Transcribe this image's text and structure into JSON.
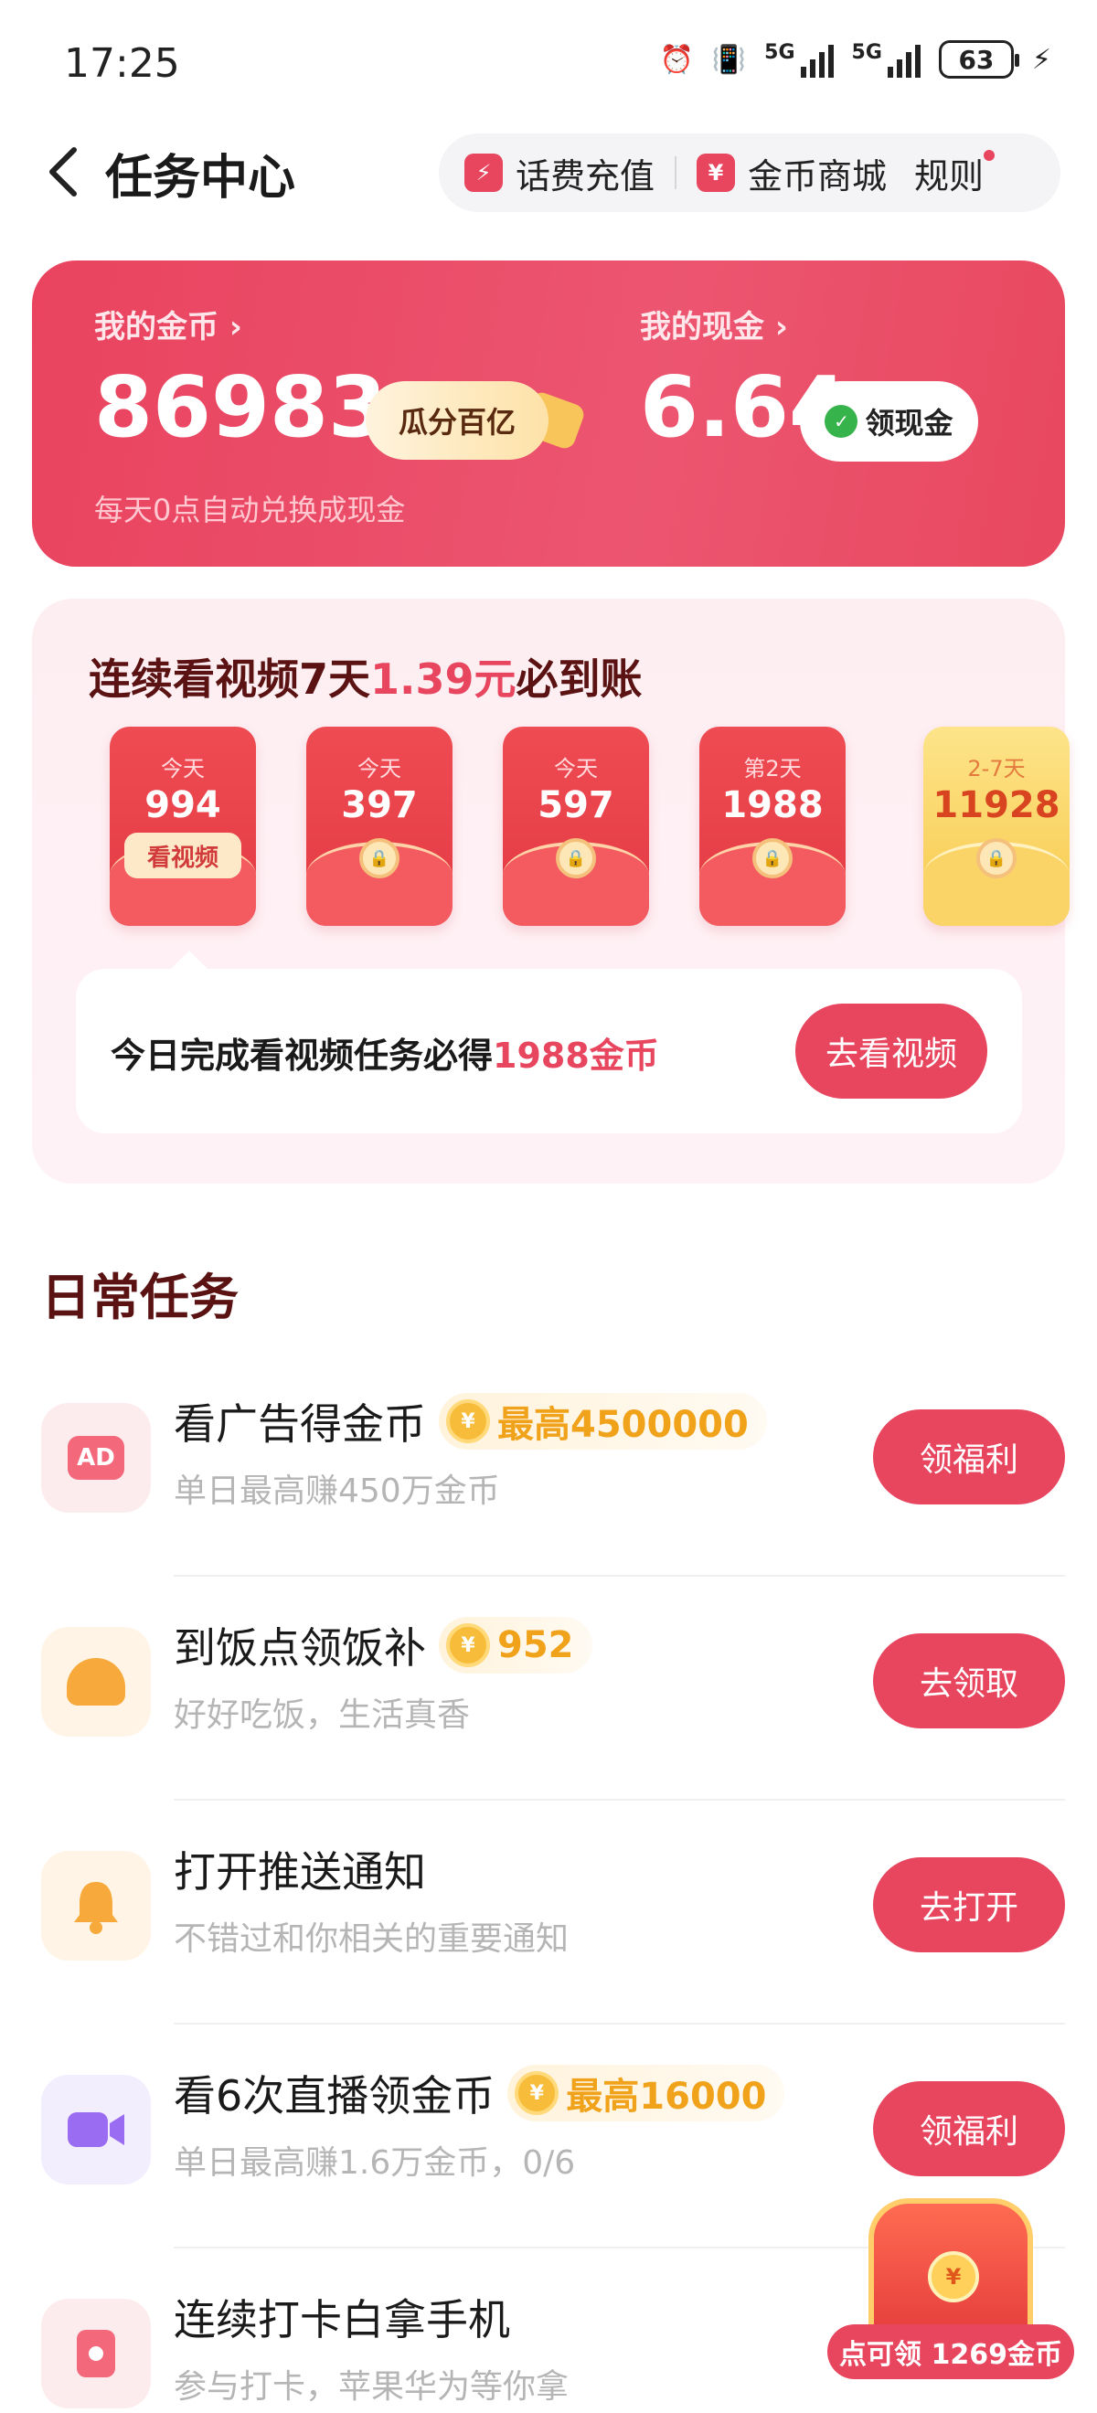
{
  "status_bar": {
    "time": "17:25",
    "net1": "5G",
    "net2": "5G",
    "battery": "63"
  },
  "header": {
    "title": "任务中心",
    "actions": [
      {
        "label": "话费充值",
        "icon": "phone-recharge-icon"
      },
      {
        "label": "金币商城",
        "icon": "coin-mall-icon"
      },
      {
        "label": "规则"
      }
    ]
  },
  "coins_card": {
    "coins_label": "我的金币 ›",
    "coins_value": "86983",
    "split_pill": "瓜分百亿",
    "cash_label": "我的现金 ›",
    "cash_value": "6.64",
    "withdraw_pill": "领现金",
    "subtitle": "每天0点自动兑换成现金"
  },
  "streak": {
    "title_a": "连续看视频7天",
    "title_hi": "1.39元",
    "title_b": "必到账",
    "envelopes": [
      {
        "day": "今天",
        "amount": "994",
        "action": "看视频"
      },
      {
        "day": "今天",
        "amount": "397"
      },
      {
        "day": "今天",
        "amount": "597"
      },
      {
        "day": "第2天",
        "amount": "1988"
      },
      {
        "day": "2-7天",
        "amount": "11928"
      }
    ],
    "box_text_a": "今日完成看视频任务必得",
    "box_text_hi": "1988金币",
    "box_button": "去看视频"
  },
  "daily": {
    "title": "日常任务",
    "tasks": [
      {
        "name": "看广告得金币",
        "reward": "最高4500000",
        "desc": "单日最高赚450万金币",
        "button": "领福利",
        "icon": "ad-icon"
      },
      {
        "name": "到饭点领饭补",
        "reward": "952",
        "desc": "好好吃饭，生活真香",
        "button": "去领取",
        "icon": "meal-icon"
      },
      {
        "name": "打开推送通知",
        "reward": "",
        "desc": "不错过和你相关的重要通知",
        "button": "去打开",
        "icon": "bell-icon"
      },
      {
        "name": "看6次直播领金币",
        "reward": "最高16000",
        "desc": "单日最高赚1.6万金币，0/6",
        "button": "领福利",
        "icon": "live-camera-icon"
      },
      {
        "name": "连续打卡白拿手机",
        "reward": "",
        "desc": "参与打卡，苹果华为等你拿",
        "button": "",
        "icon": "checkin-icon"
      }
    ]
  },
  "floating_chest": {
    "label": "点可领 1269金币"
  },
  "colors": {
    "accent": "#e8455f",
    "dark_title": "#5a1212",
    "reward_gold": "#f0a21a"
  }
}
